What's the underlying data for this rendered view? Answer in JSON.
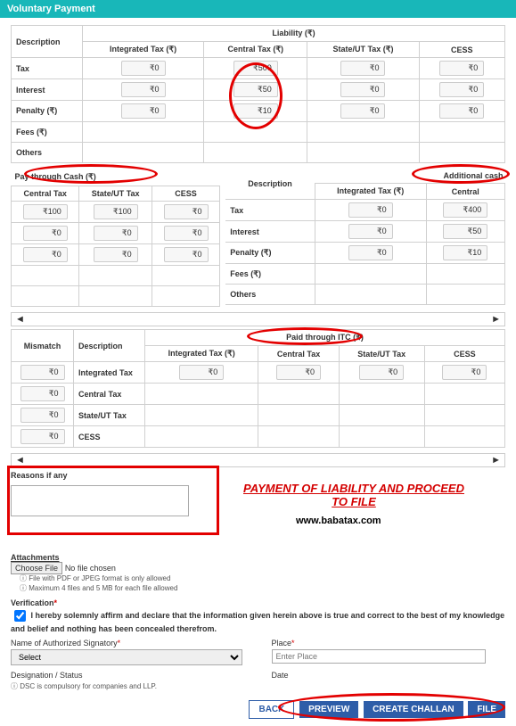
{
  "header": {
    "title": "Voluntary Payment"
  },
  "liability": {
    "caption": "Liability (₹)",
    "desc_head": "Description",
    "cols": [
      "Integrated Tax (₹)",
      "Central Tax (₹)",
      "State/UT Tax (₹)",
      "CESS"
    ],
    "rows": [
      {
        "label": "Tax",
        "vals": [
          "₹0",
          "₹500",
          "₹0",
          "₹0"
        ]
      },
      {
        "label": "Interest",
        "vals": [
          "₹0",
          "₹50",
          "₹0",
          "₹0"
        ]
      },
      {
        "label": "Penalty (₹)",
        "vals": [
          "₹0",
          "₹10",
          "₹0",
          "₹0"
        ]
      },
      {
        "label": "Fees (₹)",
        "vals": [
          "",
          "",
          "",
          ""
        ]
      },
      {
        "label": "Others",
        "vals": [
          "",
          "",
          "",
          ""
        ]
      }
    ]
  },
  "paycash": {
    "title": "Pay through Cash (₹)",
    "cols": [
      "Central Tax",
      "State/UT Tax",
      "CESS"
    ],
    "rows": [
      [
        "₹100",
        "₹100",
        "₹0"
      ],
      [
        "₹0",
        "₹0",
        "₹0"
      ],
      [
        "₹0",
        "₹0",
        "₹0"
      ],
      [
        "",
        "",
        ""
      ],
      [
        "",
        "",
        ""
      ]
    ],
    "addl_title": "Additional cash",
    "desc_head": "Description",
    "addl_cols": [
      "Integrated Tax (₹)",
      "Central"
    ],
    "addl_rows": [
      {
        "label": "Tax",
        "vals": [
          "₹0",
          "₹400"
        ]
      },
      {
        "label": "Interest",
        "vals": [
          "₹0",
          "₹50"
        ]
      },
      {
        "label": "Penalty (₹)",
        "vals": [
          "₹0",
          "₹10"
        ]
      },
      {
        "label": "Fees (₹)",
        "vals": [
          "",
          ""
        ]
      },
      {
        "label": "Others",
        "vals": [
          "",
          ""
        ]
      }
    ]
  },
  "itc": {
    "title": "Paid through ITC (₹)",
    "mismatch": "Mismatch",
    "desc_head": "Description",
    "cols": [
      "Integrated Tax (₹)",
      "Central Tax",
      "State/UT Tax",
      "CESS"
    ],
    "rows": [
      {
        "m": "₹0",
        "label": "Integrated Tax",
        "vals": [
          "₹0",
          "₹0",
          "₹0",
          "₹0"
        ]
      },
      {
        "m": "₹0",
        "label": "Central Tax",
        "vals": [
          "",
          "",
          "",
          ""
        ]
      },
      {
        "m": "₹0",
        "label": "State/UT Tax",
        "vals": [
          "",
          "",
          "",
          ""
        ]
      },
      {
        "m": "₹0",
        "label": "CESS",
        "vals": [
          "",
          "",
          "",
          ""
        ]
      }
    ]
  },
  "reasons": {
    "label": "Reasons if any"
  },
  "attach": {
    "label": "Attachments",
    "choose": "Choose File",
    "nofile": "No file chosen",
    "note1": "File with PDF or JPEG format is only allowed",
    "note2": "Maximum 4 files and 5 MB for each file allowed"
  },
  "verify": {
    "label": "Verification",
    "text": "I hereby solemnly affirm and declare that the information given herein above is true and correct to the best of my knowledge and belief and nothing has been concealed therefrom."
  },
  "sig": {
    "label": "Name of Authorized Signatory",
    "sel": "Select"
  },
  "place": {
    "label": "Place",
    "ph": "Enter Place"
  },
  "desig": {
    "label": "Designation / Status"
  },
  "date": {
    "label": "Date"
  },
  "dsc": "DSC is compulsory for companies and LLP.",
  "btns": {
    "back": "BACK",
    "preview": "PREVIEW",
    "challan": "CREATE CHALLAN",
    "file": "FILE"
  },
  "overlay": {
    "big": "PAYMENT OF LIABILITY AND PROCEED TO FILE",
    "url": "www.babatax.com"
  }
}
